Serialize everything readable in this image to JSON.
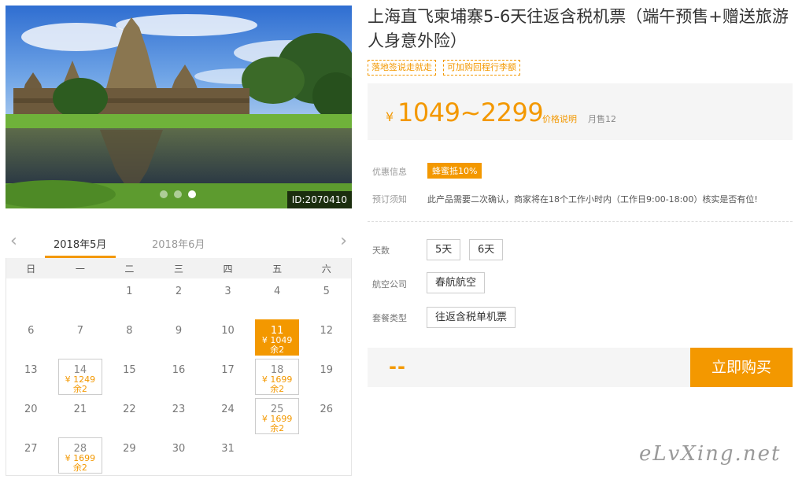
{
  "product": {
    "title": "上海直飞柬埔寨5-6天往返含税机票（端午预售+赠送旅游人身意外险）",
    "tags": [
      "落地签说走就走",
      "可加购回程行李额"
    ],
    "image_id": "ID:2070410",
    "carousel": {
      "count": 3,
      "active_index": 2
    }
  },
  "price": {
    "currency": "¥",
    "range": "1049~2299",
    "explain_label": "价格说明",
    "monthly_sales": "月售12"
  },
  "info": {
    "promo_label": "优惠信息",
    "promo_badge": "蜂蜜抵10%",
    "notice_label": "预订须知",
    "notice_text": "此产品需要二次确认，商家将在18个工作小时内（工作日9:00-18:00）核实是否有位!"
  },
  "options": {
    "days_label": "天数",
    "days": [
      "5天",
      "6天"
    ],
    "airline_label": "航空公司",
    "airline": "春航航空",
    "package_label": "套餐类型",
    "package": "往返含税单机票"
  },
  "buy": {
    "total": "--",
    "button_label": "立即购买"
  },
  "calendar": {
    "months": [
      "2018年5月",
      "2018年6月"
    ],
    "active_month": 0,
    "weekdays": [
      "日",
      "一",
      "二",
      "三",
      "四",
      "五",
      "六"
    ],
    "leading_blank_days": 2,
    "days_in_month": 31,
    "available": {
      "11": {
        "price": "¥ 1049",
        "remaining": "余2",
        "selected": true
      },
      "14": {
        "price": "¥ 1249",
        "remaining": "余2"
      },
      "18": {
        "price": "¥ 1699",
        "remaining": "余2"
      },
      "25": {
        "price": "¥ 1699",
        "remaining": "余2"
      },
      "28": {
        "price": "¥ 1699",
        "remaining": "余2"
      }
    }
  },
  "watermark": "eLvXing.net",
  "colors": {
    "accent": "#f39800",
    "panel_bg": "#f5f5f5"
  }
}
